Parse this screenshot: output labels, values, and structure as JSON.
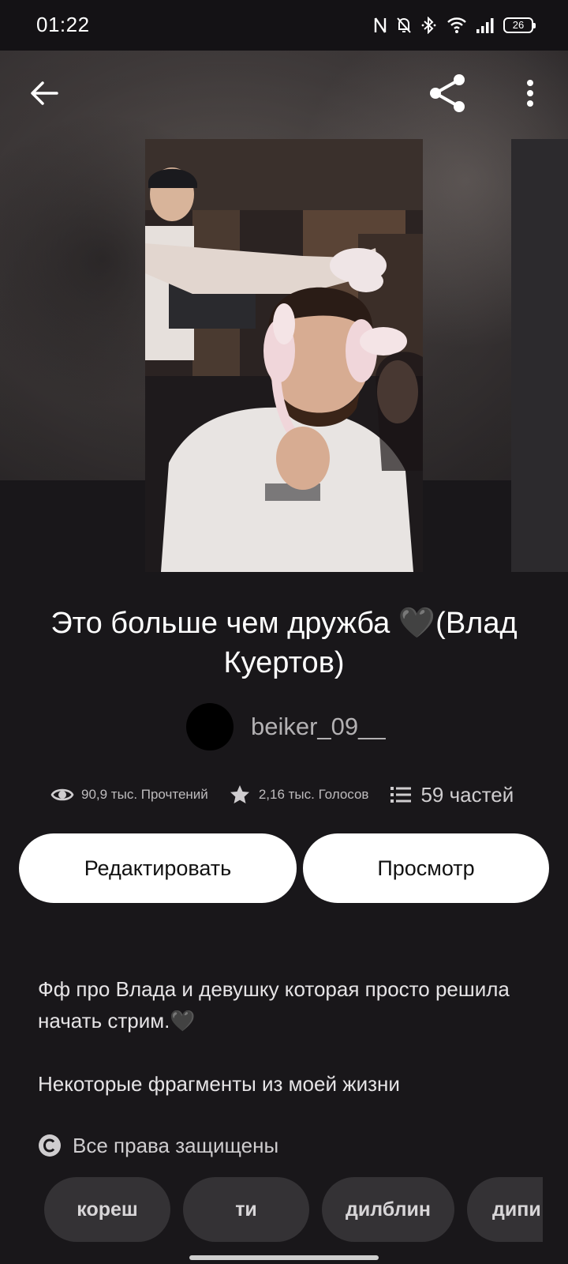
{
  "status_bar": {
    "time": "01:22",
    "battery": "26",
    "icons": [
      "nfc-icon",
      "bell-off-icon",
      "bluetooth-icon",
      "wifi-icon",
      "signal-icon",
      "battery-icon"
    ]
  },
  "toolbar": {
    "back_icon": "arrow-left-icon",
    "share_icon": "share-icon",
    "menu_icon": "more-vertical-icon"
  },
  "story": {
    "title": "Это больше чем дружба 🖤(Влад Куертов)",
    "author": "beiker_09__",
    "reads": "90,9 тыс. Прочтений",
    "votes": "2,16 тыс. Голосов",
    "parts": "59 частей"
  },
  "actions": {
    "edit_label": "Редактировать",
    "view_label": "Просмотр"
  },
  "description": {
    "line1": "Фф про Влада и девушку которая просто решила начать стрим.🖤",
    "line2": "Некоторые фрагменты из моей жизни",
    "rights": "Все права защищены"
  },
  "tags": [
    "кореш",
    "ти",
    "дилблин",
    "дипи"
  ],
  "colors": {
    "background": "#19171a",
    "button_bg": "#ffffff",
    "tag_bg": "#343235"
  }
}
